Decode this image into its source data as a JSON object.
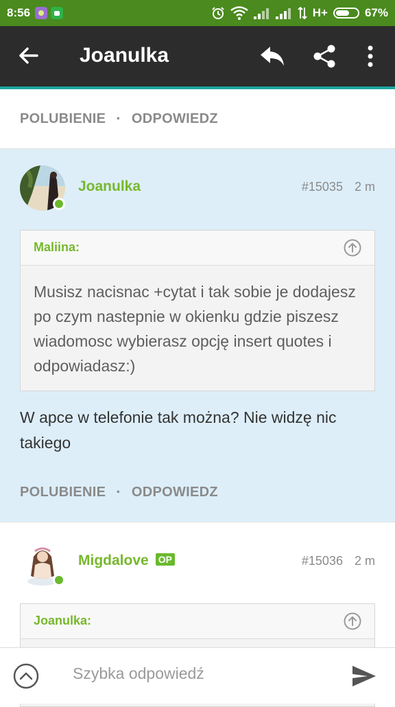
{
  "status_bar": {
    "time": "8:56",
    "network": "H+",
    "battery_percent": "67%",
    "battery_level": 0.67
  },
  "app_bar": {
    "title": "Joanulka",
    "icons": [
      "back-arrow-icon",
      "reply-icon",
      "share-icon",
      "more-vert-icon"
    ]
  },
  "first_actions": {
    "like": "POLUBIENIE",
    "separator": "·",
    "reply": "ODPOWIEDZ"
  },
  "posts": [
    {
      "author": "Joanulka",
      "number": "#15035",
      "time": "2 m",
      "op_badge": "",
      "quote": {
        "author": "Maliina:",
        "text": "Musisz nacisnac +cytat i tak sobie je dodajesz po czym nastepnie w okienku gdzie piszesz wiadomosc wybierasz opcję insert quotes i odpowiadasz:)"
      },
      "text": "W apce w telefonie tak można? Nie widzę nic takiego",
      "actions": {
        "like": "POLUBIENIE",
        "separator": "·",
        "reply": "ODPOWIEDZ"
      }
    },
    {
      "author": "Migdalove",
      "number": "#15036",
      "time": "2 m",
      "op_badge": "OP",
      "quote": {
        "author": "Joanulka:",
        "text": ""
      }
    }
  ],
  "reply_bar": {
    "placeholder": "Szybka odpowiedź"
  },
  "colors": {
    "status_bar": "#4a8a1e",
    "app_bar": "#2c2c2c",
    "accent_line": "#19a5a0",
    "username_green": "#77b82d",
    "highlight_bg": "#ddeef9"
  }
}
